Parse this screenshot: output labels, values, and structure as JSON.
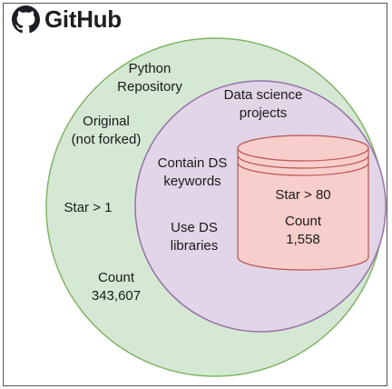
{
  "logo": {
    "wordmark": "GitHub",
    "icon": "github-octocat-icon"
  },
  "outer_region": {
    "title": "Python\nRepository",
    "criteria": [
      "Original\n(not forked)",
      "Star > 1"
    ],
    "count": "Count\n343,607",
    "fill": "#d5e8d4",
    "stroke": "#82b366"
  },
  "inner_region": {
    "title": "Data science\nprojects",
    "criteria": [
      "Contain DS\nkeywords",
      "Use DS\nlibraries"
    ],
    "fill": "#e1d5e7",
    "stroke": "#9673a6"
  },
  "cylinder": {
    "criterion": "Star > 80",
    "count": "Count\n1,558",
    "fill": "#f8cecc",
    "stroke": "#b85450"
  }
}
